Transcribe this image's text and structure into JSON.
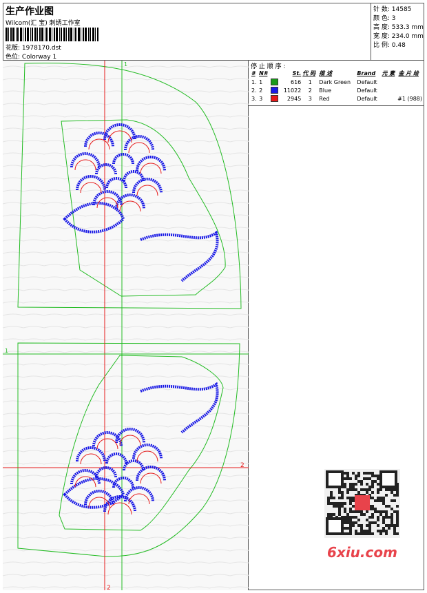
{
  "header": {
    "title": "生产作业图",
    "subtitle": "Wilcom(汇 宝) 刺绣工作室",
    "design_label": "花版:",
    "design_value": "1978170.dst",
    "colorway_label": "色位:",
    "colorway_value": "Colorway 1"
  },
  "stats": [
    {
      "label": "针 数:",
      "value": "14585"
    },
    {
      "label": "颜 色:",
      "value": "3"
    },
    {
      "label": "高 度:",
      "value": "533.3 mm"
    },
    {
      "label": "宽 度:",
      "value": "234.0 mm"
    },
    {
      "label": "比 例:",
      "value": "0.48"
    }
  ],
  "stop_sequence": {
    "title": "停 止 顺 序 :",
    "headers": [
      "#",
      "N#",
      "St.",
      "代 码",
      "描 述",
      "Brand",
      "元 素",
      "金 片 给"
    ],
    "rows": [
      {
        "n": "1.",
        "nn": "1",
        "color": "#1a9a1a",
        "st": "616",
        "code": "1",
        "desc": "Dark Green",
        "brand": "Default",
        "elem": ""
      },
      {
        "n": "2.",
        "nn": "2",
        "color": "#1a1ae6",
        "st": "11022",
        "code": "2",
        "desc": "Blue",
        "brand": "Default",
        "elem": ""
      },
      {
        "n": "3.",
        "nn": "3",
        "color": "#e61a1a",
        "st": "2945",
        "code": "3",
        "desc": "Red",
        "brand": "Default",
        "elem": "#1 (988)"
      }
    ]
  },
  "markers": {
    "m1": "1",
    "m2": "2"
  },
  "watermark": {
    "text": "6xiu.com"
  },
  "colors": {
    "outline": "#22bb22",
    "stitch": "#1a1ae6",
    "accent": "#e61a1a"
  }
}
